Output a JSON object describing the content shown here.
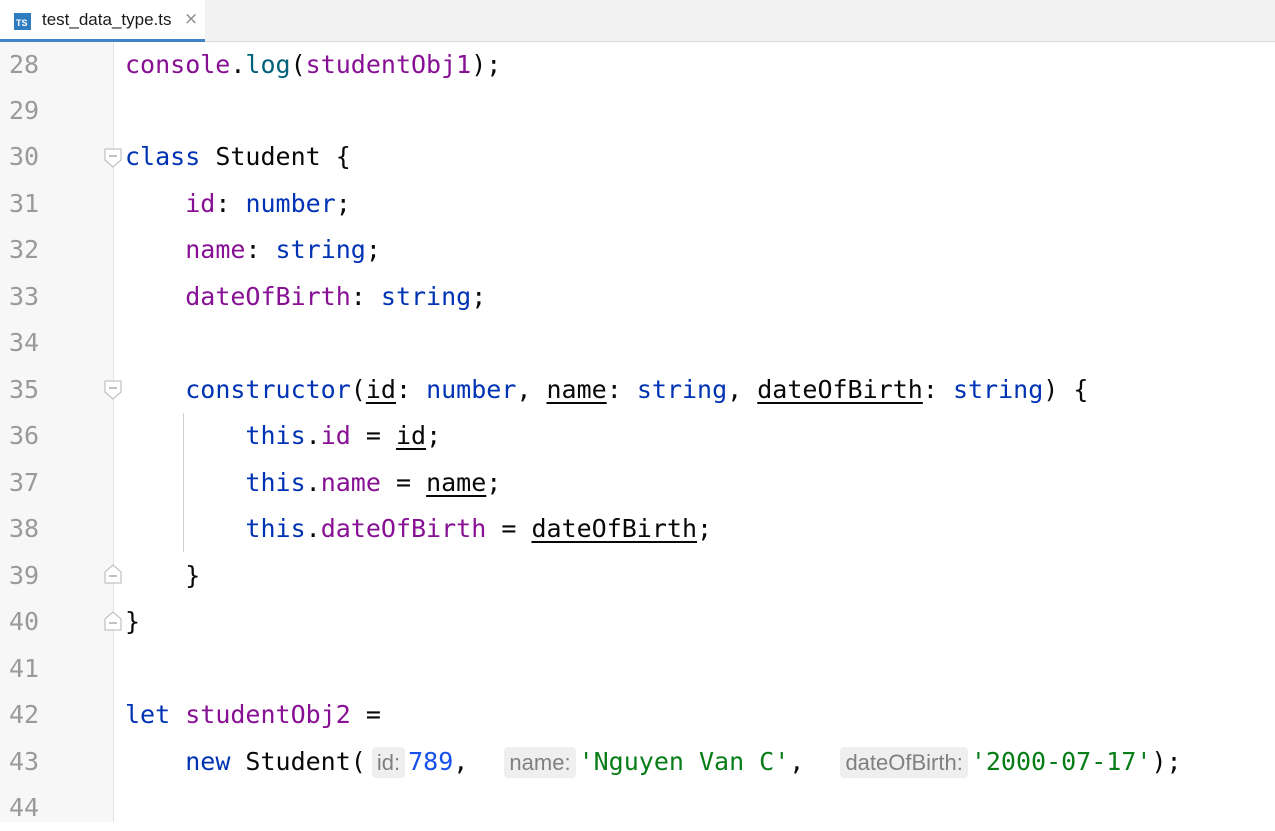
{
  "tab": {
    "title": "test_data_type.ts",
    "icon": "typescript-file-icon",
    "icon_label": "TS",
    "close_glyph": "×"
  },
  "line_numbers": [
    "28",
    "29",
    "30",
    "31",
    "32",
    "33",
    "34",
    "35",
    "36",
    "37",
    "38",
    "39",
    "40",
    "41",
    "42",
    "43",
    "44"
  ],
  "code": {
    "l28": {
      "a": "console",
      "b": ".",
      "c": "log",
      "d": "(",
      "e": "studentObj1",
      "f": ");"
    },
    "l30": {
      "a": "class",
      "b": " Student {"
    },
    "l31": {
      "a": "    ",
      "b": "id",
      "c": ": ",
      "d": "number",
      "e": ";"
    },
    "l32": {
      "a": "    ",
      "b": "name",
      "c": ": ",
      "d": "string",
      "e": ";"
    },
    "l33": {
      "a": "    ",
      "b": "dateOfBirth",
      "c": ": ",
      "d": "string",
      "e": ";"
    },
    "l35": {
      "a": "    ",
      "b": "constructor",
      "c": "(",
      "d": "id",
      "e": ": ",
      "f": "number",
      "g": ", ",
      "h": "name",
      "i": ": ",
      "j": "string",
      "k": ", ",
      "l": "dateOfBirth",
      "m": ": ",
      "n": "string",
      "o": ") {"
    },
    "l36": {
      "a": "        ",
      "b": "this",
      "c": ".",
      "d": "id",
      "e": " = ",
      "f": "id",
      "g": ";"
    },
    "l37": {
      "a": "        ",
      "b": "this",
      "c": ".",
      "d": "name",
      "e": " = ",
      "f": "name",
      "g": ";"
    },
    "l38": {
      "a": "        ",
      "b": "this",
      "c": ".",
      "d": "dateOfBirth",
      "e": " = ",
      "f": "dateOfBirth",
      "g": ";"
    },
    "l39": {
      "a": "    }"
    },
    "l40": {
      "a": "}"
    },
    "l42": {
      "a": "let",
      "b": " ",
      "c": "studentObj2",
      "d": " ="
    },
    "l43": {
      "a": "    ",
      "b": "new",
      "c": " Student(",
      "h1": "id:",
      "v1": "789",
      "s1": ",  ",
      "h2": "name:",
      "v2": "'Nguyen Van C'",
      "s2": ",  ",
      "h3": "dateOfBirth:",
      "v3": "'2000-07-17'",
      "e": ");"
    }
  },
  "colors": {
    "keyword": "#0033b3",
    "field": "#871094",
    "function": "#00627a",
    "string": "#067d17",
    "number": "#1750eb",
    "tab_accent": "#4083c9"
  }
}
